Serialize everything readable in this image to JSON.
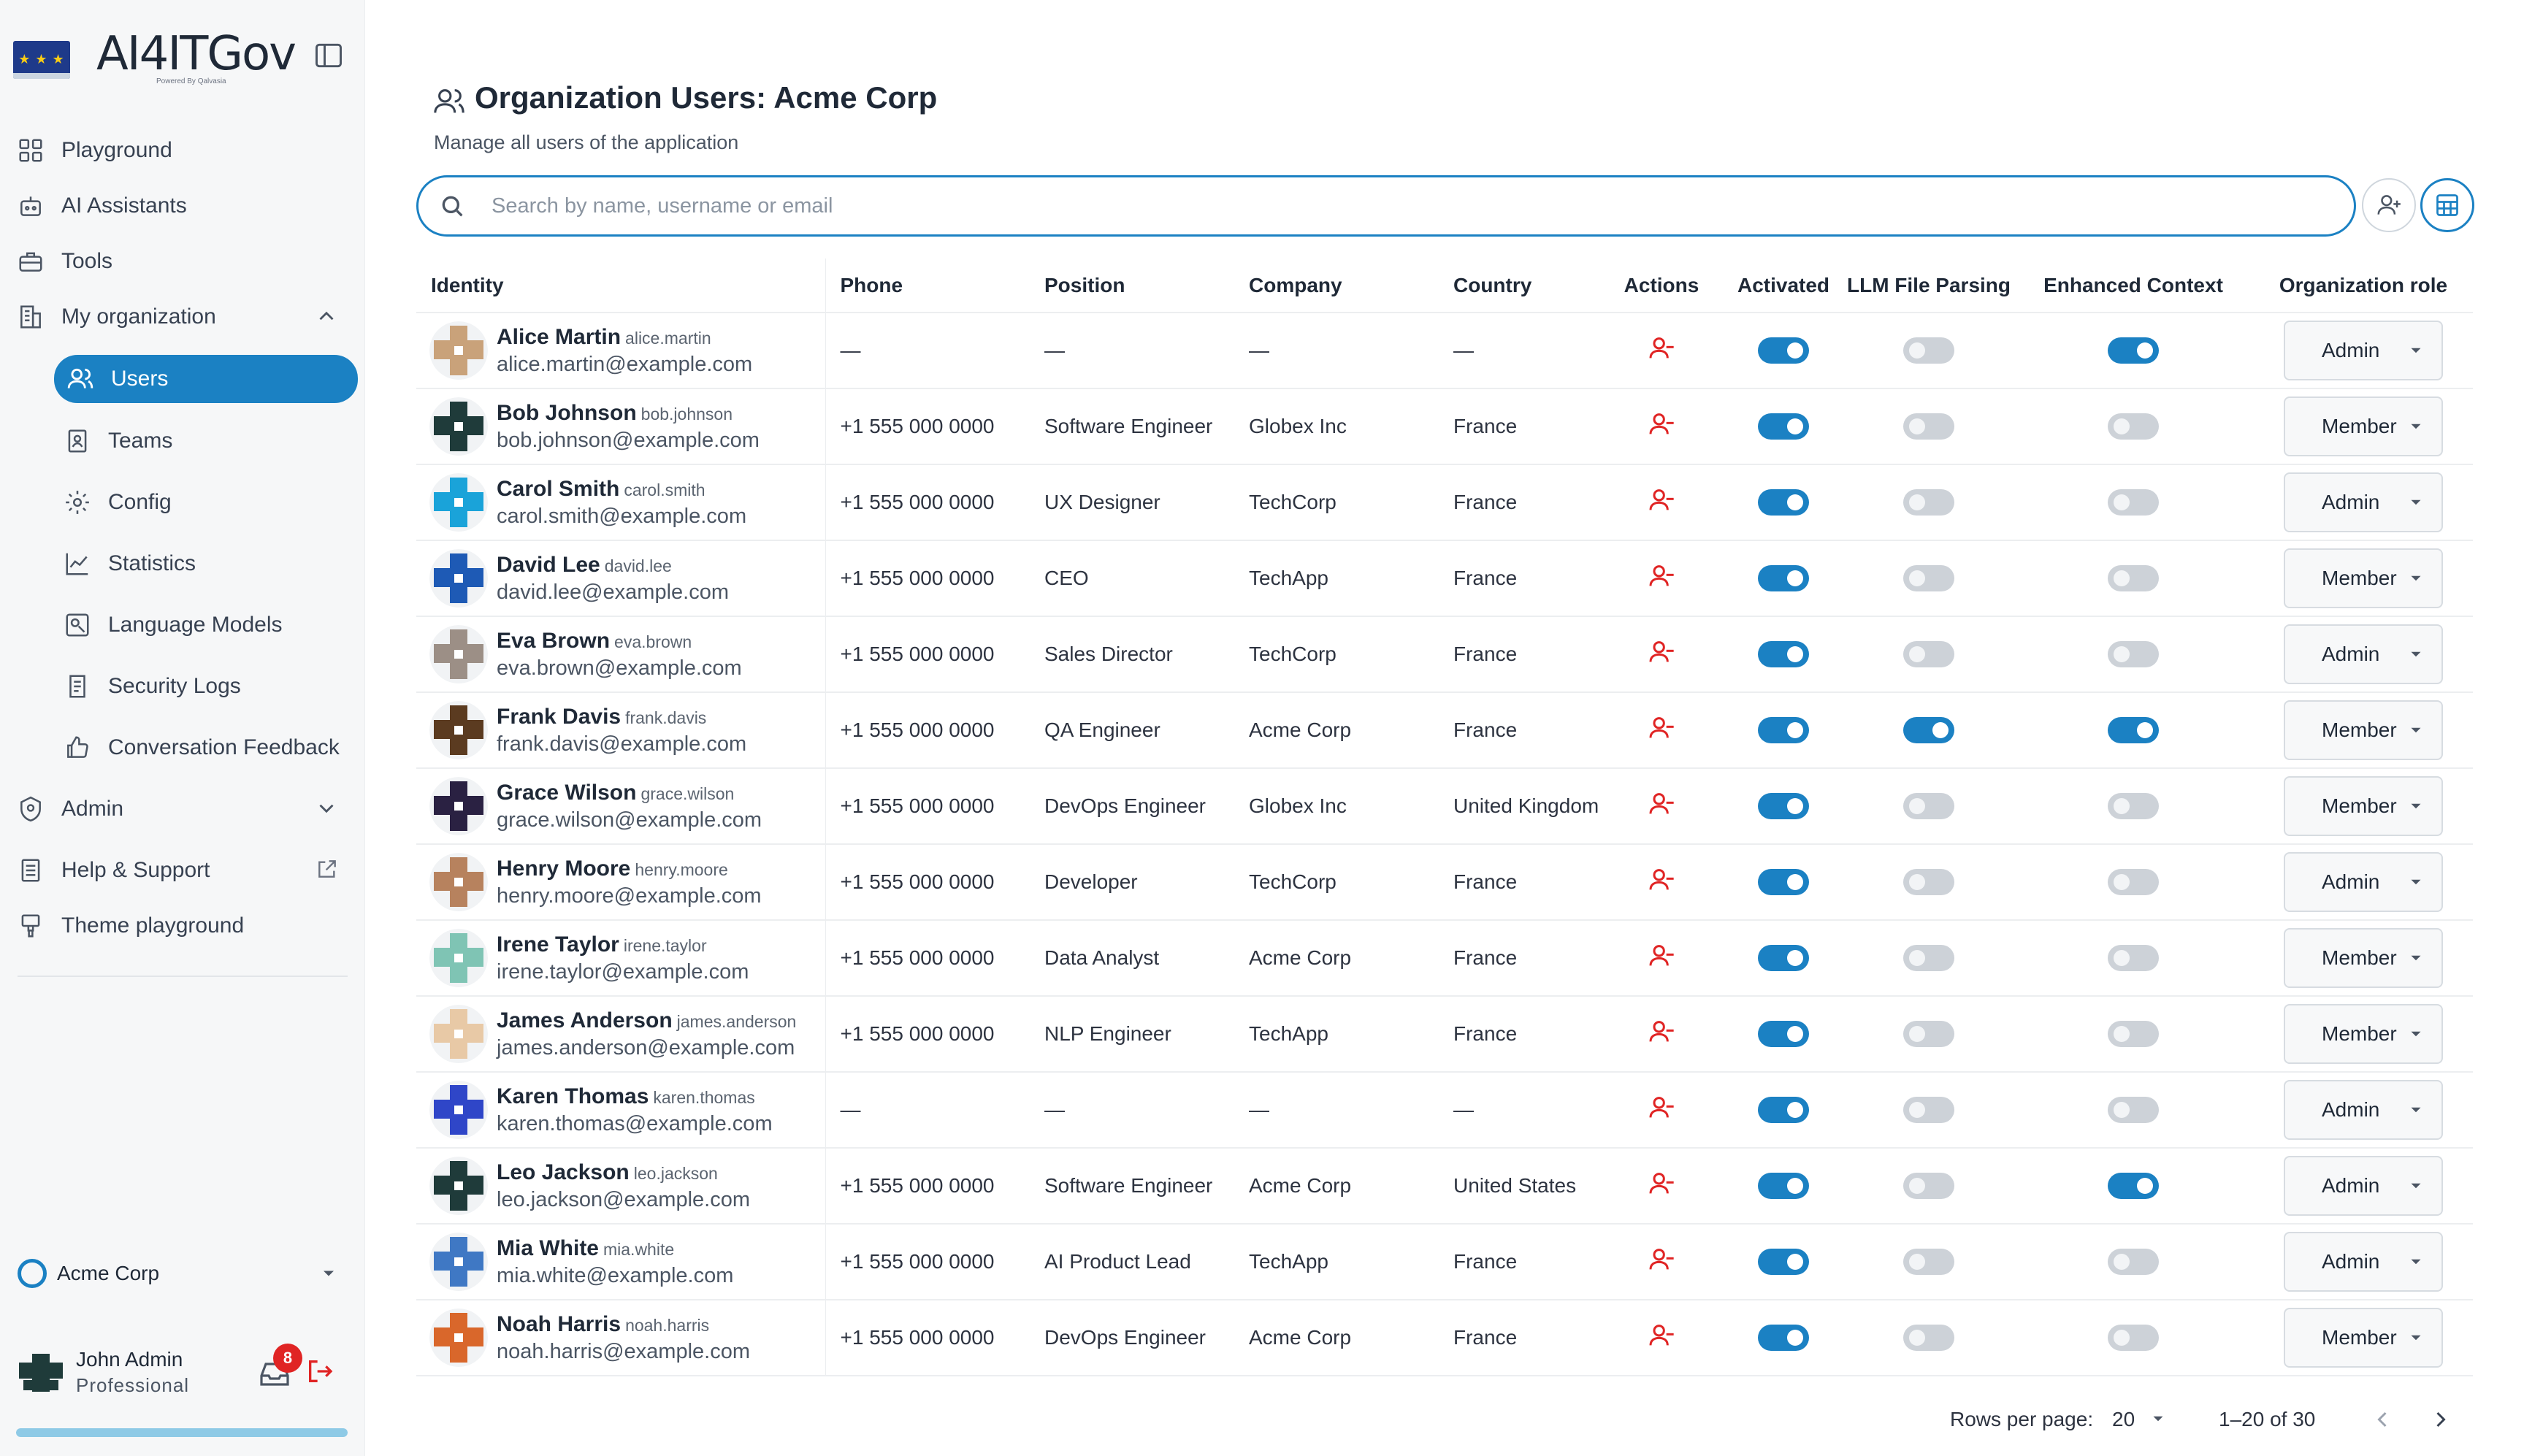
{
  "app": {
    "brand": "AI4ITGov",
    "brand_sub": "Powered By Qalvasia"
  },
  "colors": {
    "accent": "#1b81c3",
    "danger": "#e02424"
  },
  "sidebar": {
    "items": [
      {
        "label": "Playground",
        "icon": "grid-icon"
      },
      {
        "label": "AI Assistants",
        "icon": "robot-icon"
      },
      {
        "label": "Tools",
        "icon": "toolbox-icon"
      },
      {
        "label": "My organization",
        "icon": "building-icon"
      }
    ],
    "org_items": [
      {
        "label": "Users",
        "icon": "users-icon",
        "active": true
      },
      {
        "label": "Teams",
        "icon": "id-badge-icon"
      },
      {
        "label": "Config",
        "icon": "gear-icon"
      },
      {
        "label": "Statistics",
        "icon": "chart-icon"
      },
      {
        "label": "Language Models",
        "icon": "model-icon"
      },
      {
        "label": "Security Logs",
        "icon": "log-icon"
      },
      {
        "label": "Conversation Feedback",
        "icon": "feedback-icon"
      }
    ],
    "bottom_items": [
      {
        "label": "Admin",
        "icon": "shield-icon"
      },
      {
        "label": "Help & Support",
        "icon": "document-icon"
      },
      {
        "label": "Theme playground",
        "icon": "brush-icon"
      }
    ],
    "organization": "Acme Corp",
    "user": {
      "name": "John Admin",
      "plan": "Professional",
      "notifications": "8"
    },
    "usage_progress": 1.0
  },
  "header": {
    "title": "Organization Users: Acme Corp",
    "subtitle": "Manage all users of the application"
  },
  "search": {
    "placeholder": "Search by name, username or email",
    "value": ""
  },
  "table": {
    "columns": [
      "Identity",
      "Phone",
      "Position",
      "Company",
      "Country",
      "Actions",
      "Activated",
      "LLM File Parsing",
      "Enhanced Context",
      "Organization role"
    ],
    "rows": [
      {
        "name": "Alice Martin",
        "username": "alice.martin",
        "email": "alice.martin@example.com",
        "phone": "—",
        "position": "—",
        "company": "—",
        "country": "—",
        "activated": true,
        "llm": false,
        "enhanced": true,
        "role": "Admin"
      },
      {
        "name": "Bob Johnson",
        "username": "bob.johnson",
        "email": "bob.johnson@example.com",
        "phone": "+1 555 000 0000",
        "position": "Software Engineer",
        "company": "Globex Inc",
        "country": "France",
        "activated": true,
        "llm": false,
        "enhanced": false,
        "role": "Member"
      },
      {
        "name": "Carol Smith",
        "username": "carol.smith",
        "email": "carol.smith@example.com",
        "phone": "+1 555 000 0000",
        "position": "UX Designer",
        "company": "TechCorp",
        "country": "France",
        "activated": true,
        "llm": false,
        "enhanced": false,
        "role": "Admin"
      },
      {
        "name": "David Lee",
        "username": "david.lee",
        "email": "david.lee@example.com",
        "phone": "+1 555 000 0000",
        "position": "CEO",
        "company": "TechApp",
        "country": "France",
        "activated": true,
        "llm": false,
        "enhanced": false,
        "role": "Member"
      },
      {
        "name": "Eva Brown",
        "username": "eva.brown",
        "email": "eva.brown@example.com",
        "phone": "+1 555 000 0000",
        "position": "Sales Director",
        "company": "TechCorp",
        "country": "France",
        "activated": true,
        "llm": false,
        "enhanced": false,
        "role": "Admin"
      },
      {
        "name": "Frank Davis",
        "username": "frank.davis",
        "email": "frank.davis@example.com",
        "phone": "+1 555 000 0000",
        "position": "QA Engineer",
        "company": "Acme Corp",
        "country": "France",
        "activated": true,
        "llm": true,
        "enhanced": true,
        "role": "Member"
      },
      {
        "name": "Grace Wilson",
        "username": "grace.wilson",
        "email": "grace.wilson@example.com",
        "phone": "+1 555 000 0000",
        "position": "DevOps Engineer",
        "company": "Globex Inc",
        "country": "United Kingdom",
        "activated": true,
        "llm": false,
        "enhanced": false,
        "role": "Member"
      },
      {
        "name": "Henry Moore",
        "username": "henry.moore",
        "email": "henry.moore@example.com",
        "phone": "+1 555 000 0000",
        "position": "Developer",
        "company": "TechCorp",
        "country": "France",
        "activated": true,
        "llm": false,
        "enhanced": false,
        "role": "Admin"
      },
      {
        "name": "Irene Taylor",
        "username": "irene.taylor",
        "email": "irene.taylor@example.com",
        "phone": "+1 555 000 0000",
        "position": "Data Analyst",
        "company": "Acme Corp",
        "country": "France",
        "activated": true,
        "llm": false,
        "enhanced": false,
        "role": "Member"
      },
      {
        "name": "James Anderson",
        "username": "james.anderson",
        "email": "james.anderson@example.com",
        "phone": "+1 555 000 0000",
        "position": "NLP Engineer",
        "company": "TechApp",
        "country": "France",
        "activated": true,
        "llm": false,
        "enhanced": false,
        "role": "Member"
      },
      {
        "name": "Karen Thomas",
        "username": "karen.thomas",
        "email": "karen.thomas@example.com",
        "phone": "—",
        "position": "—",
        "company": "—",
        "country": "—",
        "activated": true,
        "llm": false,
        "enhanced": false,
        "role": "Admin"
      },
      {
        "name": "Leo Jackson",
        "username": "leo.jackson",
        "email": "leo.jackson@example.com",
        "phone": "+1 555 000 0000",
        "position": "Software Engineer",
        "company": "Acme Corp",
        "country": "United States",
        "activated": true,
        "llm": false,
        "enhanced": true,
        "role": "Admin"
      },
      {
        "name": "Mia White",
        "username": "mia.white",
        "email": "mia.white@example.com",
        "phone": "+1 555 000 0000",
        "position": "AI Product Lead",
        "company": "TechApp",
        "country": "France",
        "activated": true,
        "llm": false,
        "enhanced": false,
        "role": "Admin"
      },
      {
        "name": "Noah Harris",
        "username": "noah.harris",
        "email": "noah.harris@example.com",
        "phone": "+1 555 000 0000",
        "position": "DevOps Engineer",
        "company": "Acme Corp",
        "country": "France",
        "activated": true,
        "llm": false,
        "enhanced": false,
        "role": "Member"
      }
    ]
  },
  "pagination": {
    "rows_label": "Rows per page:",
    "rows_value": "20",
    "range": "1–20 of 30"
  }
}
